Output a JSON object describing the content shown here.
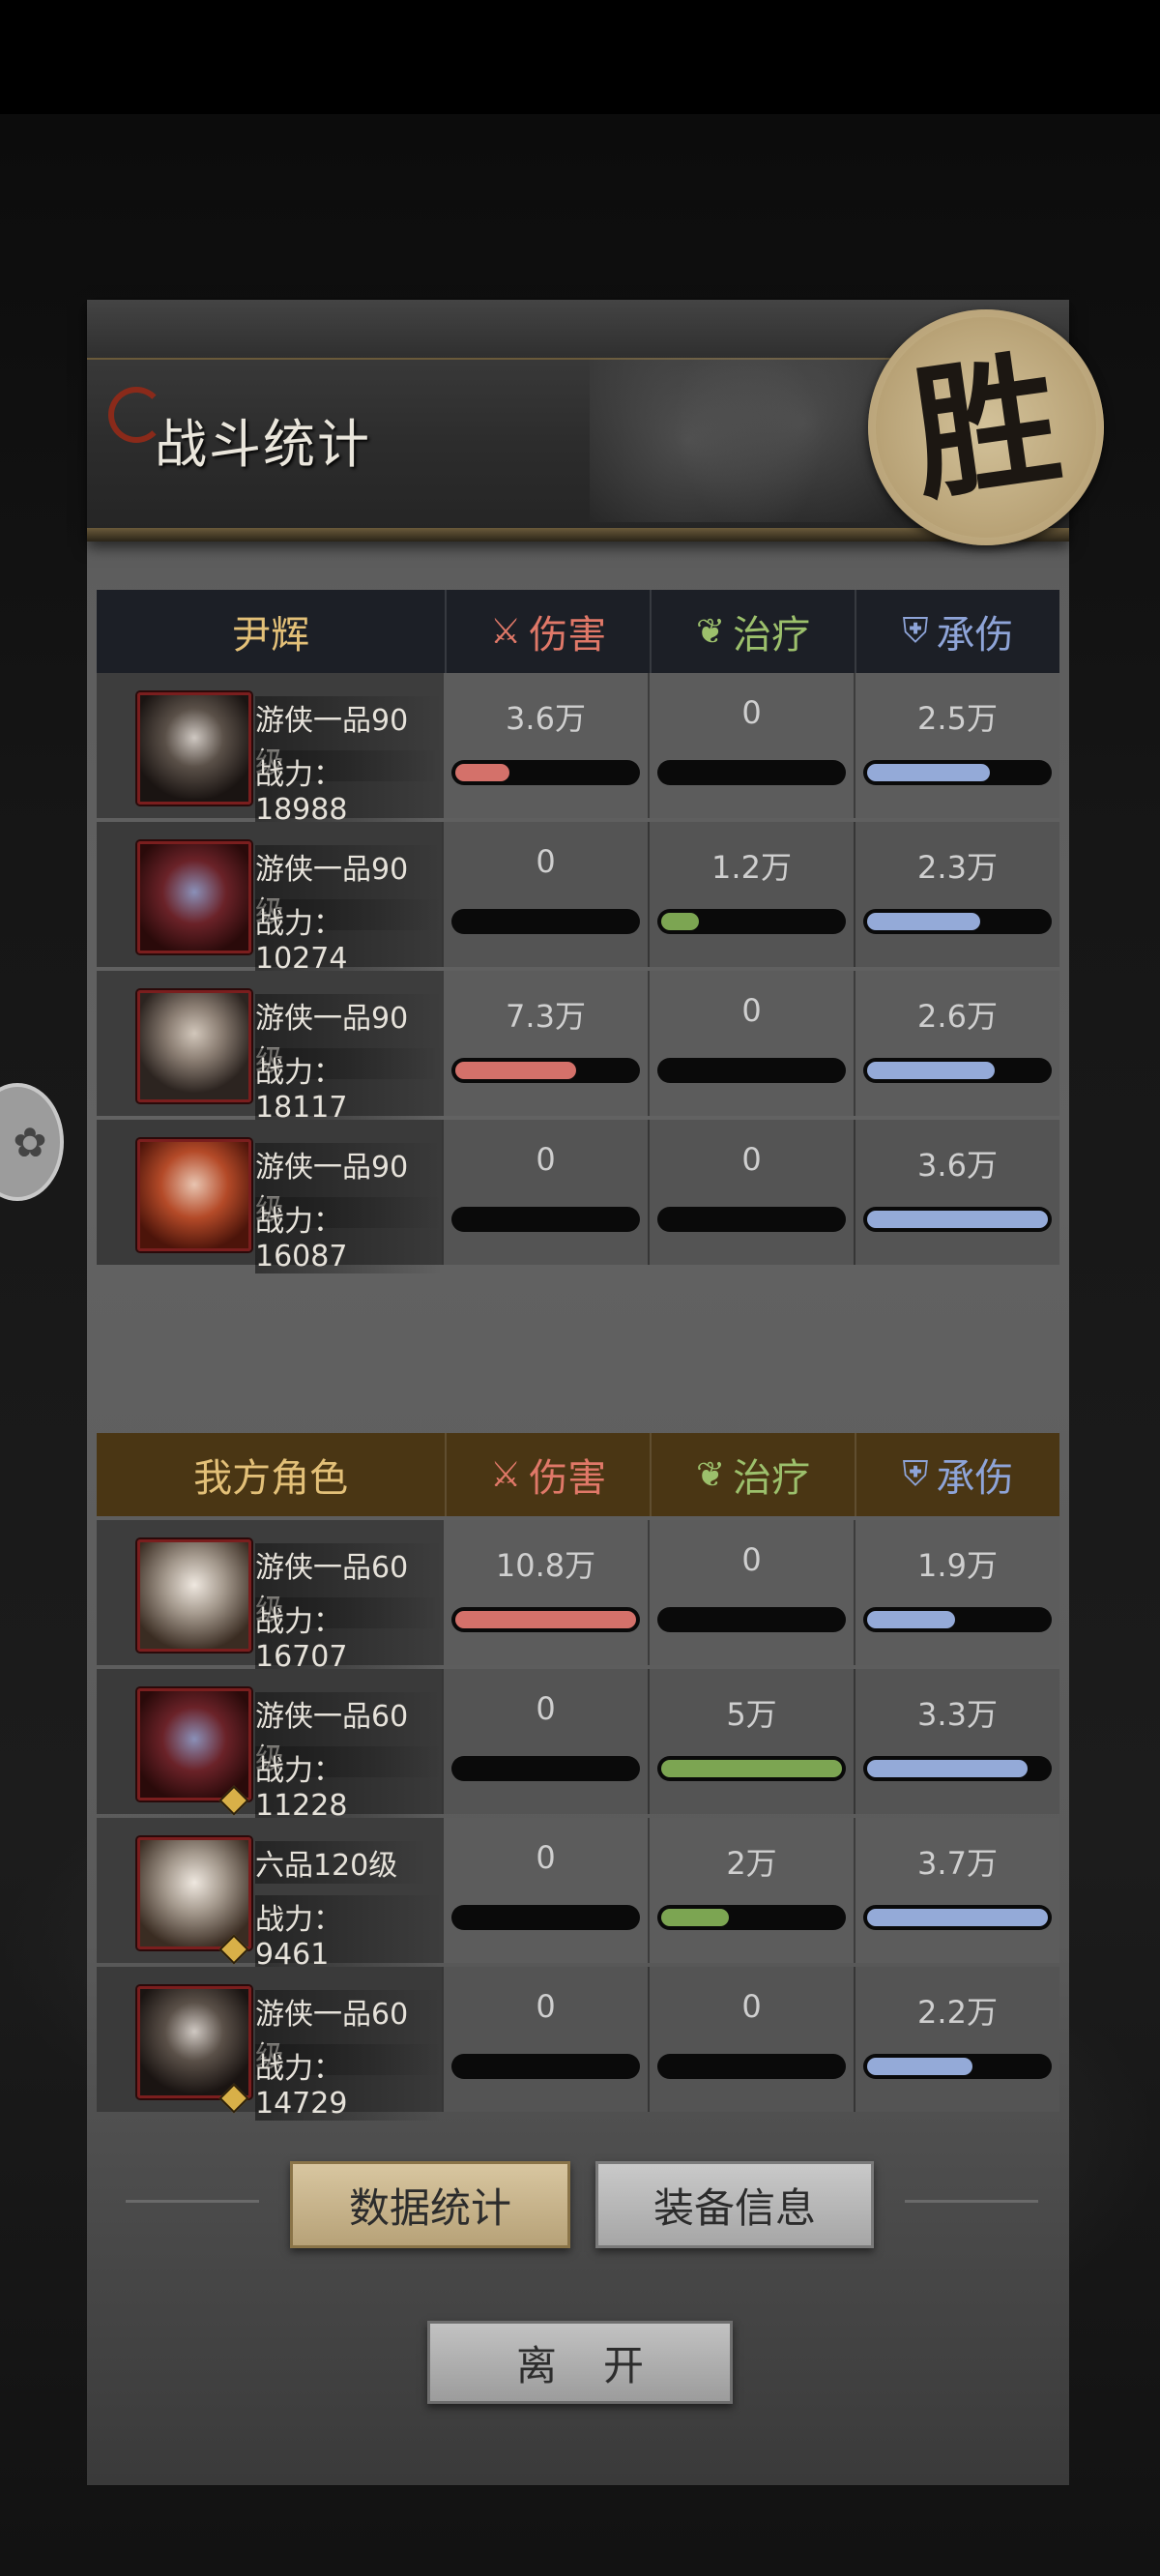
{
  "header": {
    "title": "战斗统计",
    "victory": "胜"
  },
  "columns": {
    "damage": "伤害",
    "heal": "治疗",
    "tank": "承伤"
  },
  "enemy": {
    "team_name": "尹辉",
    "rows": [
      {
        "rank": "游侠一品90级",
        "power": "战力：18988",
        "damage": "3.6万",
        "heal": "0",
        "tank": "2.5万",
        "damage_pct": 0.33,
        "heal_pct": 0,
        "tank_pct": 0.69
      },
      {
        "rank": "游侠一品90级",
        "power": "战力：10274",
        "damage": "0",
        "heal": "1.2万",
        "tank": "2.3万",
        "damage_pct": 0,
        "heal_pct": 0.24,
        "tank_pct": 0.64
      },
      {
        "rank": "游侠一品90级",
        "power": "战力：18117",
        "damage": "7.3万",
        "heal": "0",
        "tank": "2.6万",
        "damage_pct": 0.68,
        "heal_pct": 0,
        "tank_pct": 0.72
      },
      {
        "rank": "游侠一品90级",
        "power": "战力：16087",
        "damage": "0",
        "heal": "0",
        "tank": "3.6万",
        "damage_pct": 0,
        "heal_pct": 0,
        "tank_pct": 1.0
      }
    ]
  },
  "ally": {
    "team_name": "我方角色",
    "rows": [
      {
        "rank": "游侠一品60级",
        "power": "战力：16707",
        "damage": "10.8万",
        "heal": "0",
        "tank": "1.9万",
        "damage_pct": 1.0,
        "heal_pct": 0,
        "tank_pct": 0.51
      },
      {
        "rank": "游侠一品60级",
        "power": "战力：11228",
        "damage": "0",
        "heal": "5万",
        "tank": "3.3万",
        "damage_pct": 0,
        "heal_pct": 1.0,
        "tank_pct": 0.89
      },
      {
        "rank": "六品120级",
        "power": "战力：9461",
        "damage": "0",
        "heal": "2万",
        "tank": "3.7万",
        "damage_pct": 0,
        "heal_pct": 0.4,
        "tank_pct": 1.0
      },
      {
        "rank": "游侠一品60级",
        "power": "战力：14729",
        "damage": "0",
        "heal": "0",
        "tank": "2.2万",
        "damage_pct": 0,
        "heal_pct": 0,
        "tank_pct": 0.6
      }
    ]
  },
  "buttons": {
    "stats": "数据统计",
    "equipment": "装备信息",
    "leave": "离开"
  },
  "icons": {
    "damage": "sword-icon",
    "heal": "leaf-icon",
    "tank": "shield-icon",
    "float": "gift-icon"
  },
  "colors": {
    "damage": "#d4716a",
    "heal": "#7ca552",
    "tank": "#94aad8",
    "gold": "#e3c078"
  }
}
